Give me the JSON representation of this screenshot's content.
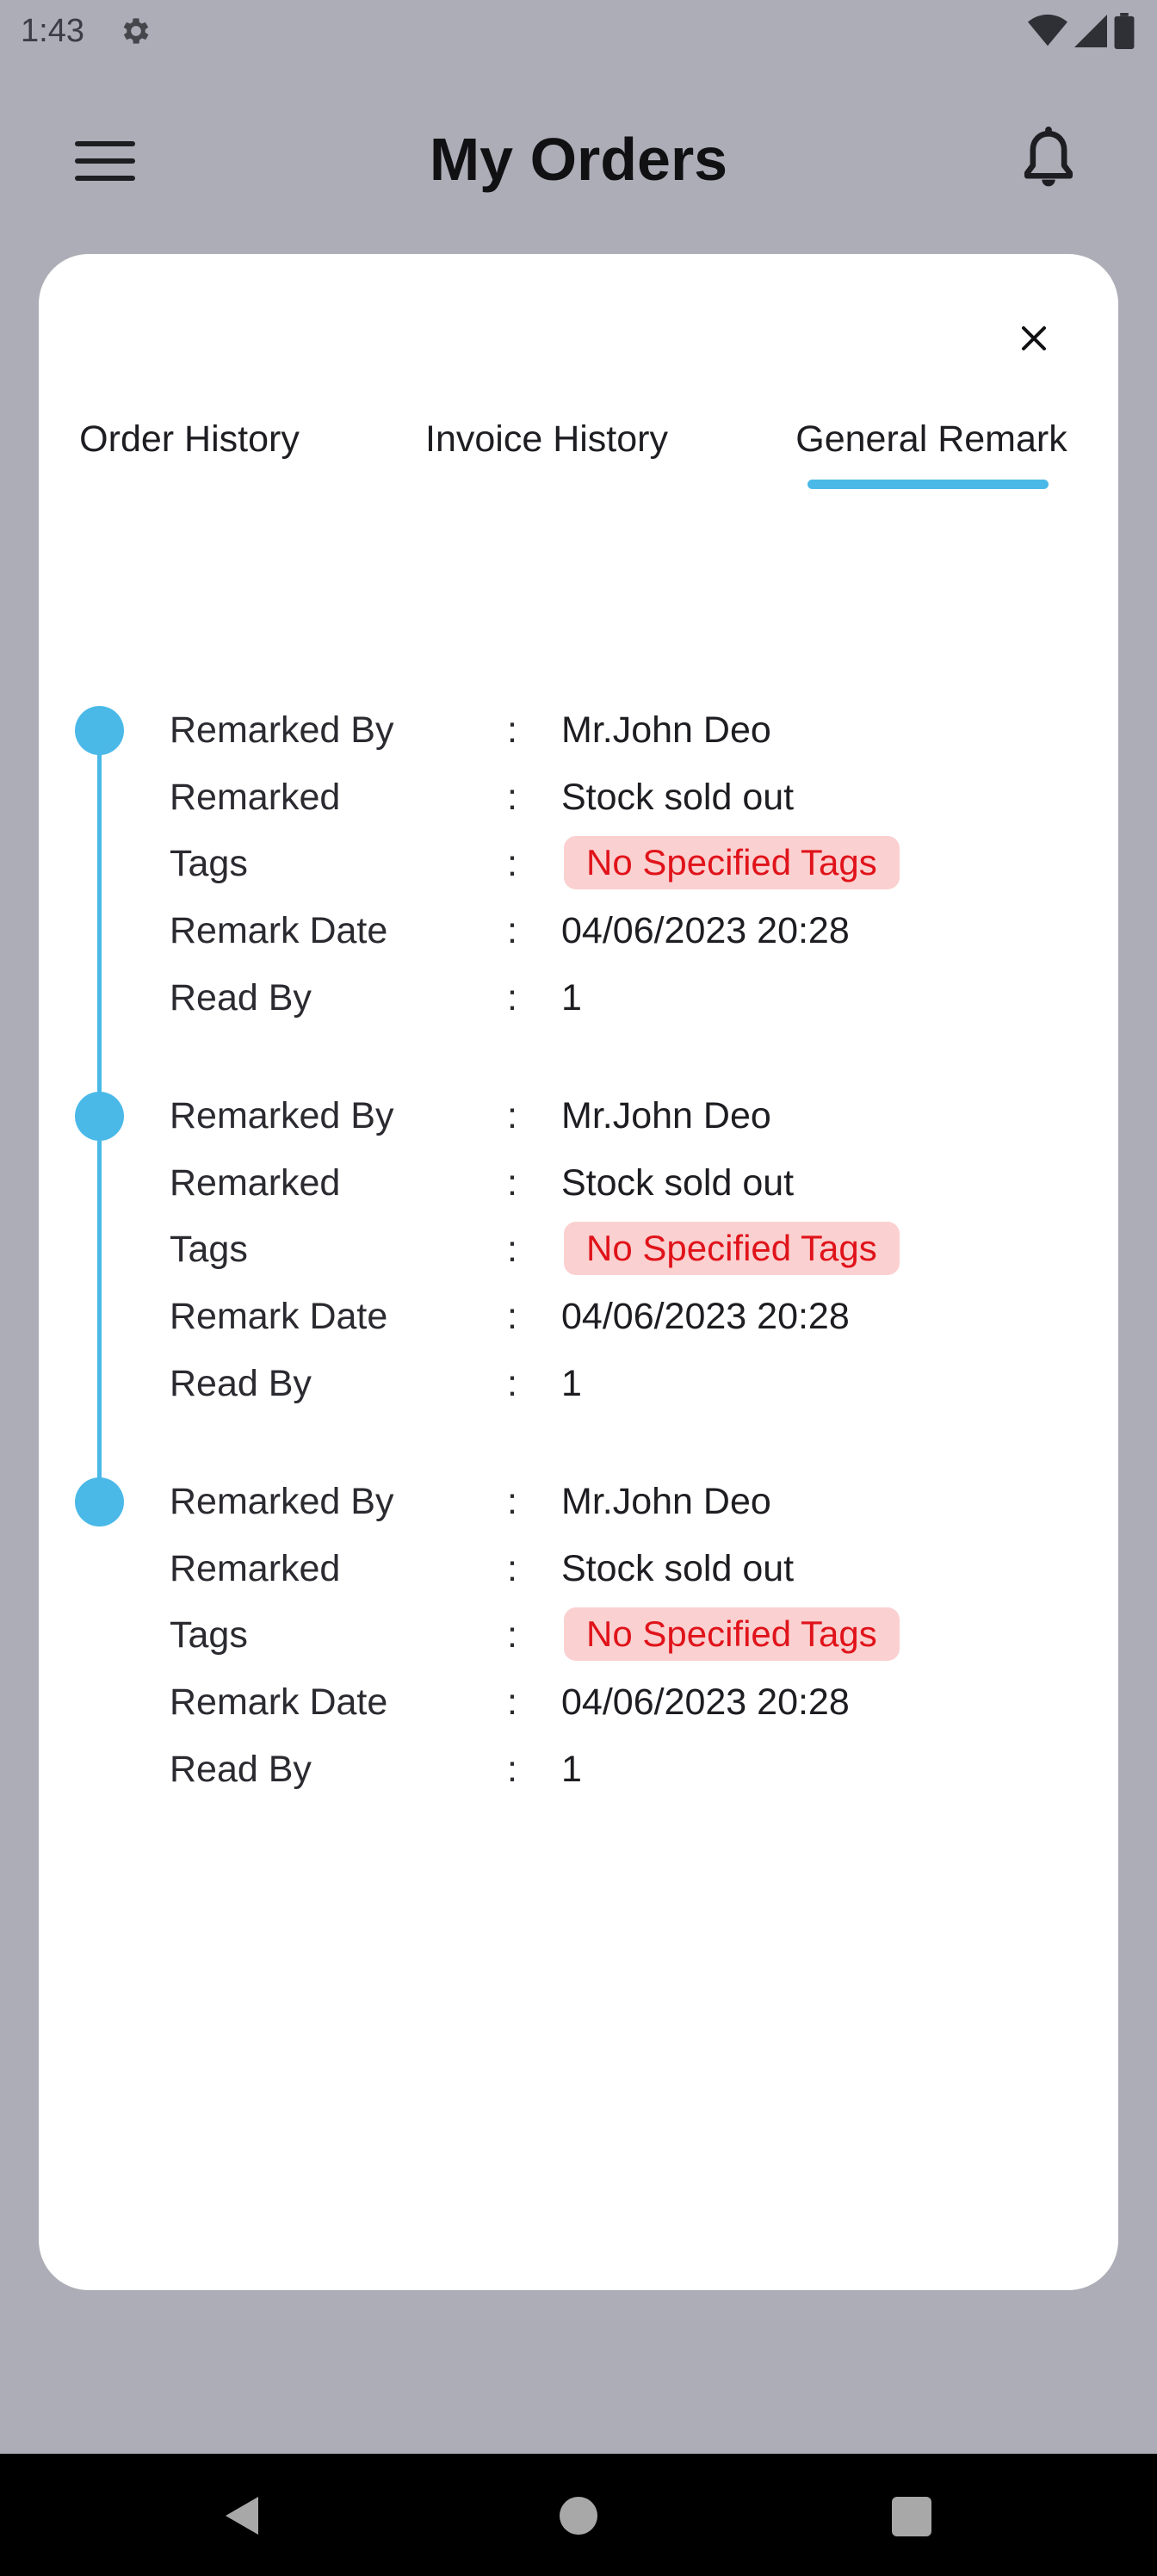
{
  "status_bar": {
    "time": "1:43",
    "icons": [
      "settings-gear-icon",
      "wifi-icon",
      "cellular-signal-icon",
      "battery-icon"
    ]
  },
  "app_bar": {
    "title": "My Orders",
    "menu_icon": "hamburger-menu-icon",
    "notification_icon": "bell-icon"
  },
  "sheet": {
    "close_icon": "close-icon",
    "tabs": [
      {
        "label": "Order History",
        "selected": false
      },
      {
        "label": "Invoice History",
        "selected": false
      },
      {
        "label": "General Remark",
        "selected": true
      }
    ],
    "accent_color": "#4ab9e8"
  },
  "remarks": [
    {
      "fields": [
        {
          "label": "Remarked By",
          "colon": ":",
          "value": "Mr.John Deo"
        },
        {
          "label": "Remarked",
          "colon": ":",
          "value": "Stock sold out"
        },
        {
          "label": "Tags",
          "colon": ":",
          "value": "No Specified Tags"
        },
        {
          "label": "Remark Date",
          "colon": ":",
          "value": "04/06/2023 20:28"
        },
        {
          "label": "Read By",
          "colon": ":",
          "value": "1"
        }
      ]
    },
    {
      "fields": [
        {
          "label": "Remarked By",
          "colon": ":",
          "value": "Mr.John Deo"
        },
        {
          "label": "Remarked",
          "colon": ":",
          "value": "Stock sold out"
        },
        {
          "label": "Tags",
          "colon": ":",
          "value": "No Specified Tags"
        },
        {
          "label": "Remark Date",
          "colon": ":",
          "value": "04/06/2023 20:28"
        },
        {
          "label": "Read By",
          "colon": ":",
          "value": "1"
        }
      ]
    },
    {
      "fields": [
        {
          "label": "Remarked By",
          "colon": ":",
          "value": "Mr.John Deo"
        },
        {
          "label": "Remarked",
          "colon": ":",
          "value": "Stock sold out"
        },
        {
          "label": "Tags",
          "colon": ":",
          "value": "No Specified Tags"
        },
        {
          "label": "Remark Date",
          "colon": ":",
          "value": "04/06/2023 20:28"
        },
        {
          "label": "Read By",
          "colon": ":",
          "value": "1"
        }
      ]
    }
  ],
  "tag_colors": {
    "background": "#fbd0d0",
    "text": "#e0131a"
  },
  "nav_bar": {
    "icons": [
      "back-icon",
      "home-icon",
      "recents-icon"
    ]
  }
}
